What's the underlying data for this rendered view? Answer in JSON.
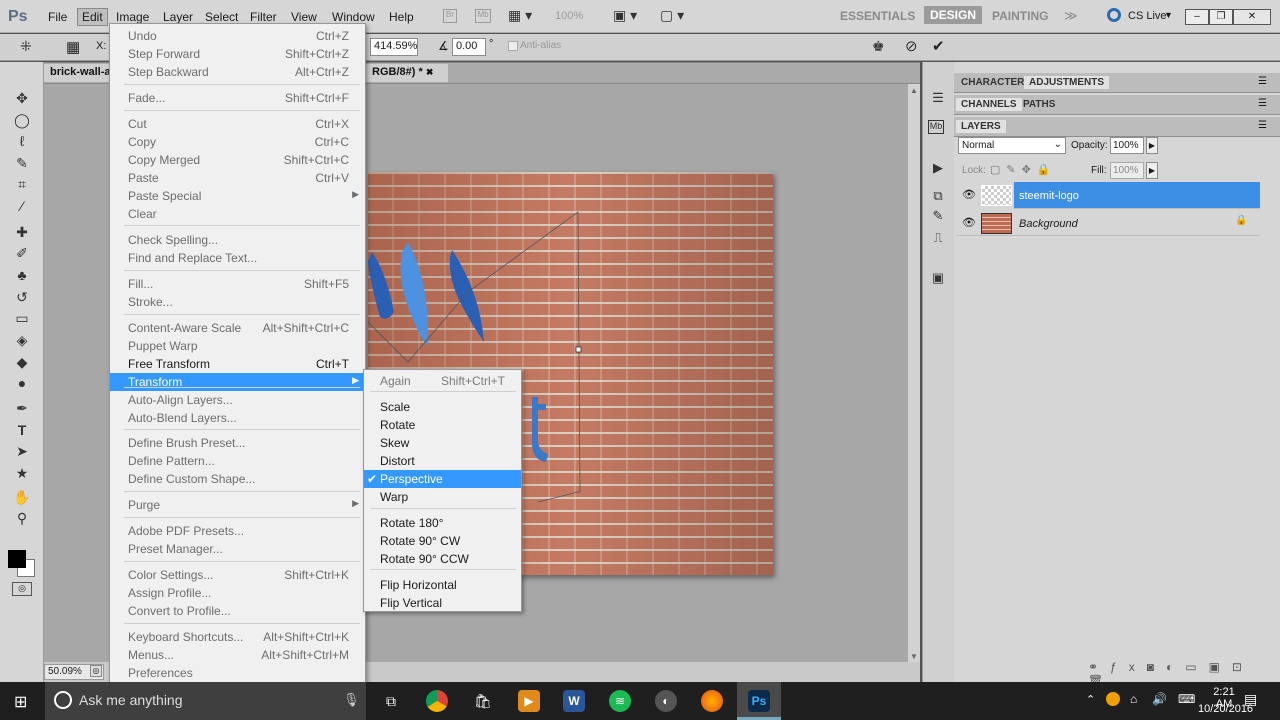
{
  "menubar": {
    "logo": "Ps",
    "items": [
      "File",
      "Edit",
      "Image",
      "Layer",
      "Select",
      "Filter",
      "View",
      "Window",
      "Help"
    ],
    "zoom": "100%",
    "workspaces": [
      "ESSENTIALS",
      "DESIGN",
      "PAINTING"
    ],
    "cslive": "CS Live"
  },
  "options": {
    "x_label": "X:",
    "zoom_pct": "414.59%",
    "angle": "0.00",
    "angle_unit": "°",
    "antialias": "Anti-alias"
  },
  "doc": {
    "tab1": "brick-wall-an",
    "tab2": "RGB/8#) *",
    "zoom_status": "50.09%"
  },
  "edit_menu": [
    {
      "label": "Undo",
      "shortcut": "Ctrl+Z",
      "enabled": false
    },
    {
      "label": "Step Forward",
      "shortcut": "Shift+Ctrl+Z",
      "enabled": false
    },
    {
      "label": "Step Backward",
      "shortcut": "Alt+Ctrl+Z",
      "enabled": false
    },
    {
      "label": "Fade...",
      "shortcut": "Shift+Ctrl+F",
      "enabled": false
    },
    {
      "label": "Cut",
      "shortcut": "Ctrl+X",
      "enabled": false
    },
    {
      "label": "Copy",
      "shortcut": "Ctrl+C",
      "enabled": false
    },
    {
      "label": "Copy Merged",
      "shortcut": "Shift+Ctrl+C",
      "enabled": false
    },
    {
      "label": "Paste",
      "shortcut": "Ctrl+V",
      "enabled": false
    },
    {
      "label": "Paste Special",
      "shortcut": "",
      "enabled": false
    },
    {
      "label": "Clear",
      "shortcut": "",
      "enabled": false
    },
    {
      "label": "Check Spelling...",
      "shortcut": "",
      "enabled": false
    },
    {
      "label": "Find and Replace Text...",
      "shortcut": "",
      "enabled": false
    },
    {
      "label": "Fill...",
      "shortcut": "Shift+F5",
      "enabled": false
    },
    {
      "label": "Stroke...",
      "shortcut": "",
      "enabled": false
    },
    {
      "label": "Content-Aware Scale",
      "shortcut": "Alt+Shift+Ctrl+C",
      "enabled": false
    },
    {
      "label": "Puppet Warp",
      "shortcut": "",
      "enabled": false
    },
    {
      "label": "Free Transform",
      "shortcut": "Ctrl+T",
      "enabled": true
    },
    {
      "label": "Transform",
      "shortcut": "",
      "enabled": true
    },
    {
      "label": "Auto-Align Layers...",
      "shortcut": "",
      "enabled": false
    },
    {
      "label": "Auto-Blend Layers...",
      "shortcut": "",
      "enabled": false
    },
    {
      "label": "Define Brush Preset...",
      "shortcut": "",
      "enabled": false
    },
    {
      "label": "Define Pattern...",
      "shortcut": "",
      "enabled": false
    },
    {
      "label": "Define Custom Shape...",
      "shortcut": "",
      "enabled": false
    },
    {
      "label": "Purge",
      "shortcut": "",
      "enabled": false
    },
    {
      "label": "Adobe PDF Presets...",
      "shortcut": "",
      "enabled": false
    },
    {
      "label": "Preset Manager...",
      "shortcut": "",
      "enabled": false
    },
    {
      "label": "Color Settings...",
      "shortcut": "Shift+Ctrl+K",
      "enabled": false
    },
    {
      "label": "Assign Profile...",
      "shortcut": "",
      "enabled": false
    },
    {
      "label": "Convert to Profile...",
      "shortcut": "",
      "enabled": false
    },
    {
      "label": "Keyboard Shortcuts...",
      "shortcut": "Alt+Shift+Ctrl+K",
      "enabled": false
    },
    {
      "label": "Menus...",
      "shortcut": "Alt+Shift+Ctrl+M",
      "enabled": false
    },
    {
      "label": "Preferences",
      "shortcut": "",
      "enabled": false
    }
  ],
  "transform_menu": [
    {
      "label": "Again",
      "shortcut": "Shift+Ctrl+T"
    },
    {
      "label": "Scale"
    },
    {
      "label": "Rotate"
    },
    {
      "label": "Skew"
    },
    {
      "label": "Distort"
    },
    {
      "label": "Perspective",
      "checked": "✔"
    },
    {
      "label": "Warp"
    },
    {
      "label": "Rotate 180°"
    },
    {
      "label": "Rotate 90° CW"
    },
    {
      "label": "Rotate 90° CCW"
    },
    {
      "label": "Flip Horizontal"
    },
    {
      "label": "Flip Vertical"
    }
  ],
  "panels": {
    "tabs_top": [
      "CHARACTER",
      "ADJUSTMENTS"
    ],
    "tabs_mid": [
      "CHANNELS",
      "PATHS"
    ],
    "layers_tab": "LAYERS",
    "blend_mode": "Normal",
    "opacity_label": "Opacity:",
    "opacity": "100%",
    "lock_label": "Lock:",
    "fill_label": "Fill:",
    "fill": "100%",
    "layers": [
      "steemit-logo",
      "Background"
    ]
  },
  "taskbar": {
    "search_placeholder": "Ask me anything",
    "time": "2:21 AM",
    "date": "10/20/2016",
    "ps_label": "Ps",
    "word_label": "W"
  }
}
